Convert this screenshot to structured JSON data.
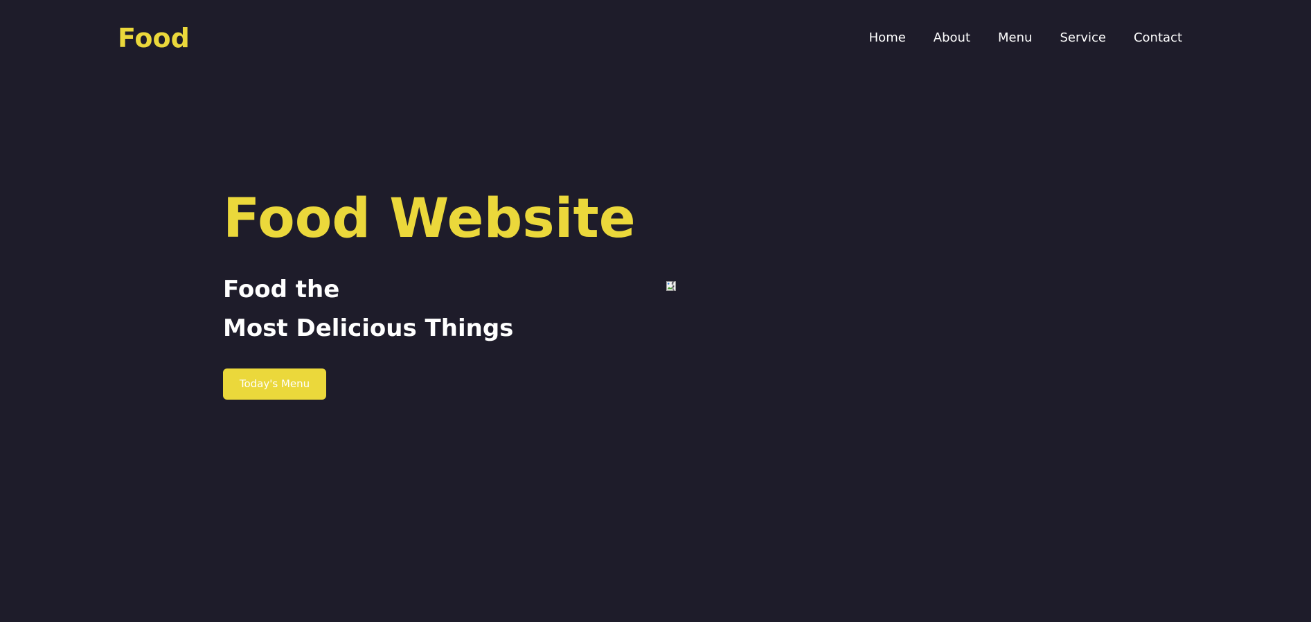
{
  "header": {
    "logo": "Food",
    "nav": [
      {
        "label": "Home"
      },
      {
        "label": "About"
      },
      {
        "label": "Menu"
      },
      {
        "label": "Service"
      },
      {
        "label": "Contact"
      }
    ]
  },
  "hero": {
    "title": "Food Website",
    "subtitle_line1": "Food the",
    "subtitle_line2": "Most Delicious Things",
    "cta_label": "Today's Menu"
  },
  "colors": {
    "background": "#1e1c2a",
    "accent": "#ebd83b",
    "text": "#ffffff"
  },
  "icons": {
    "hero_image": "broken-image-icon"
  }
}
